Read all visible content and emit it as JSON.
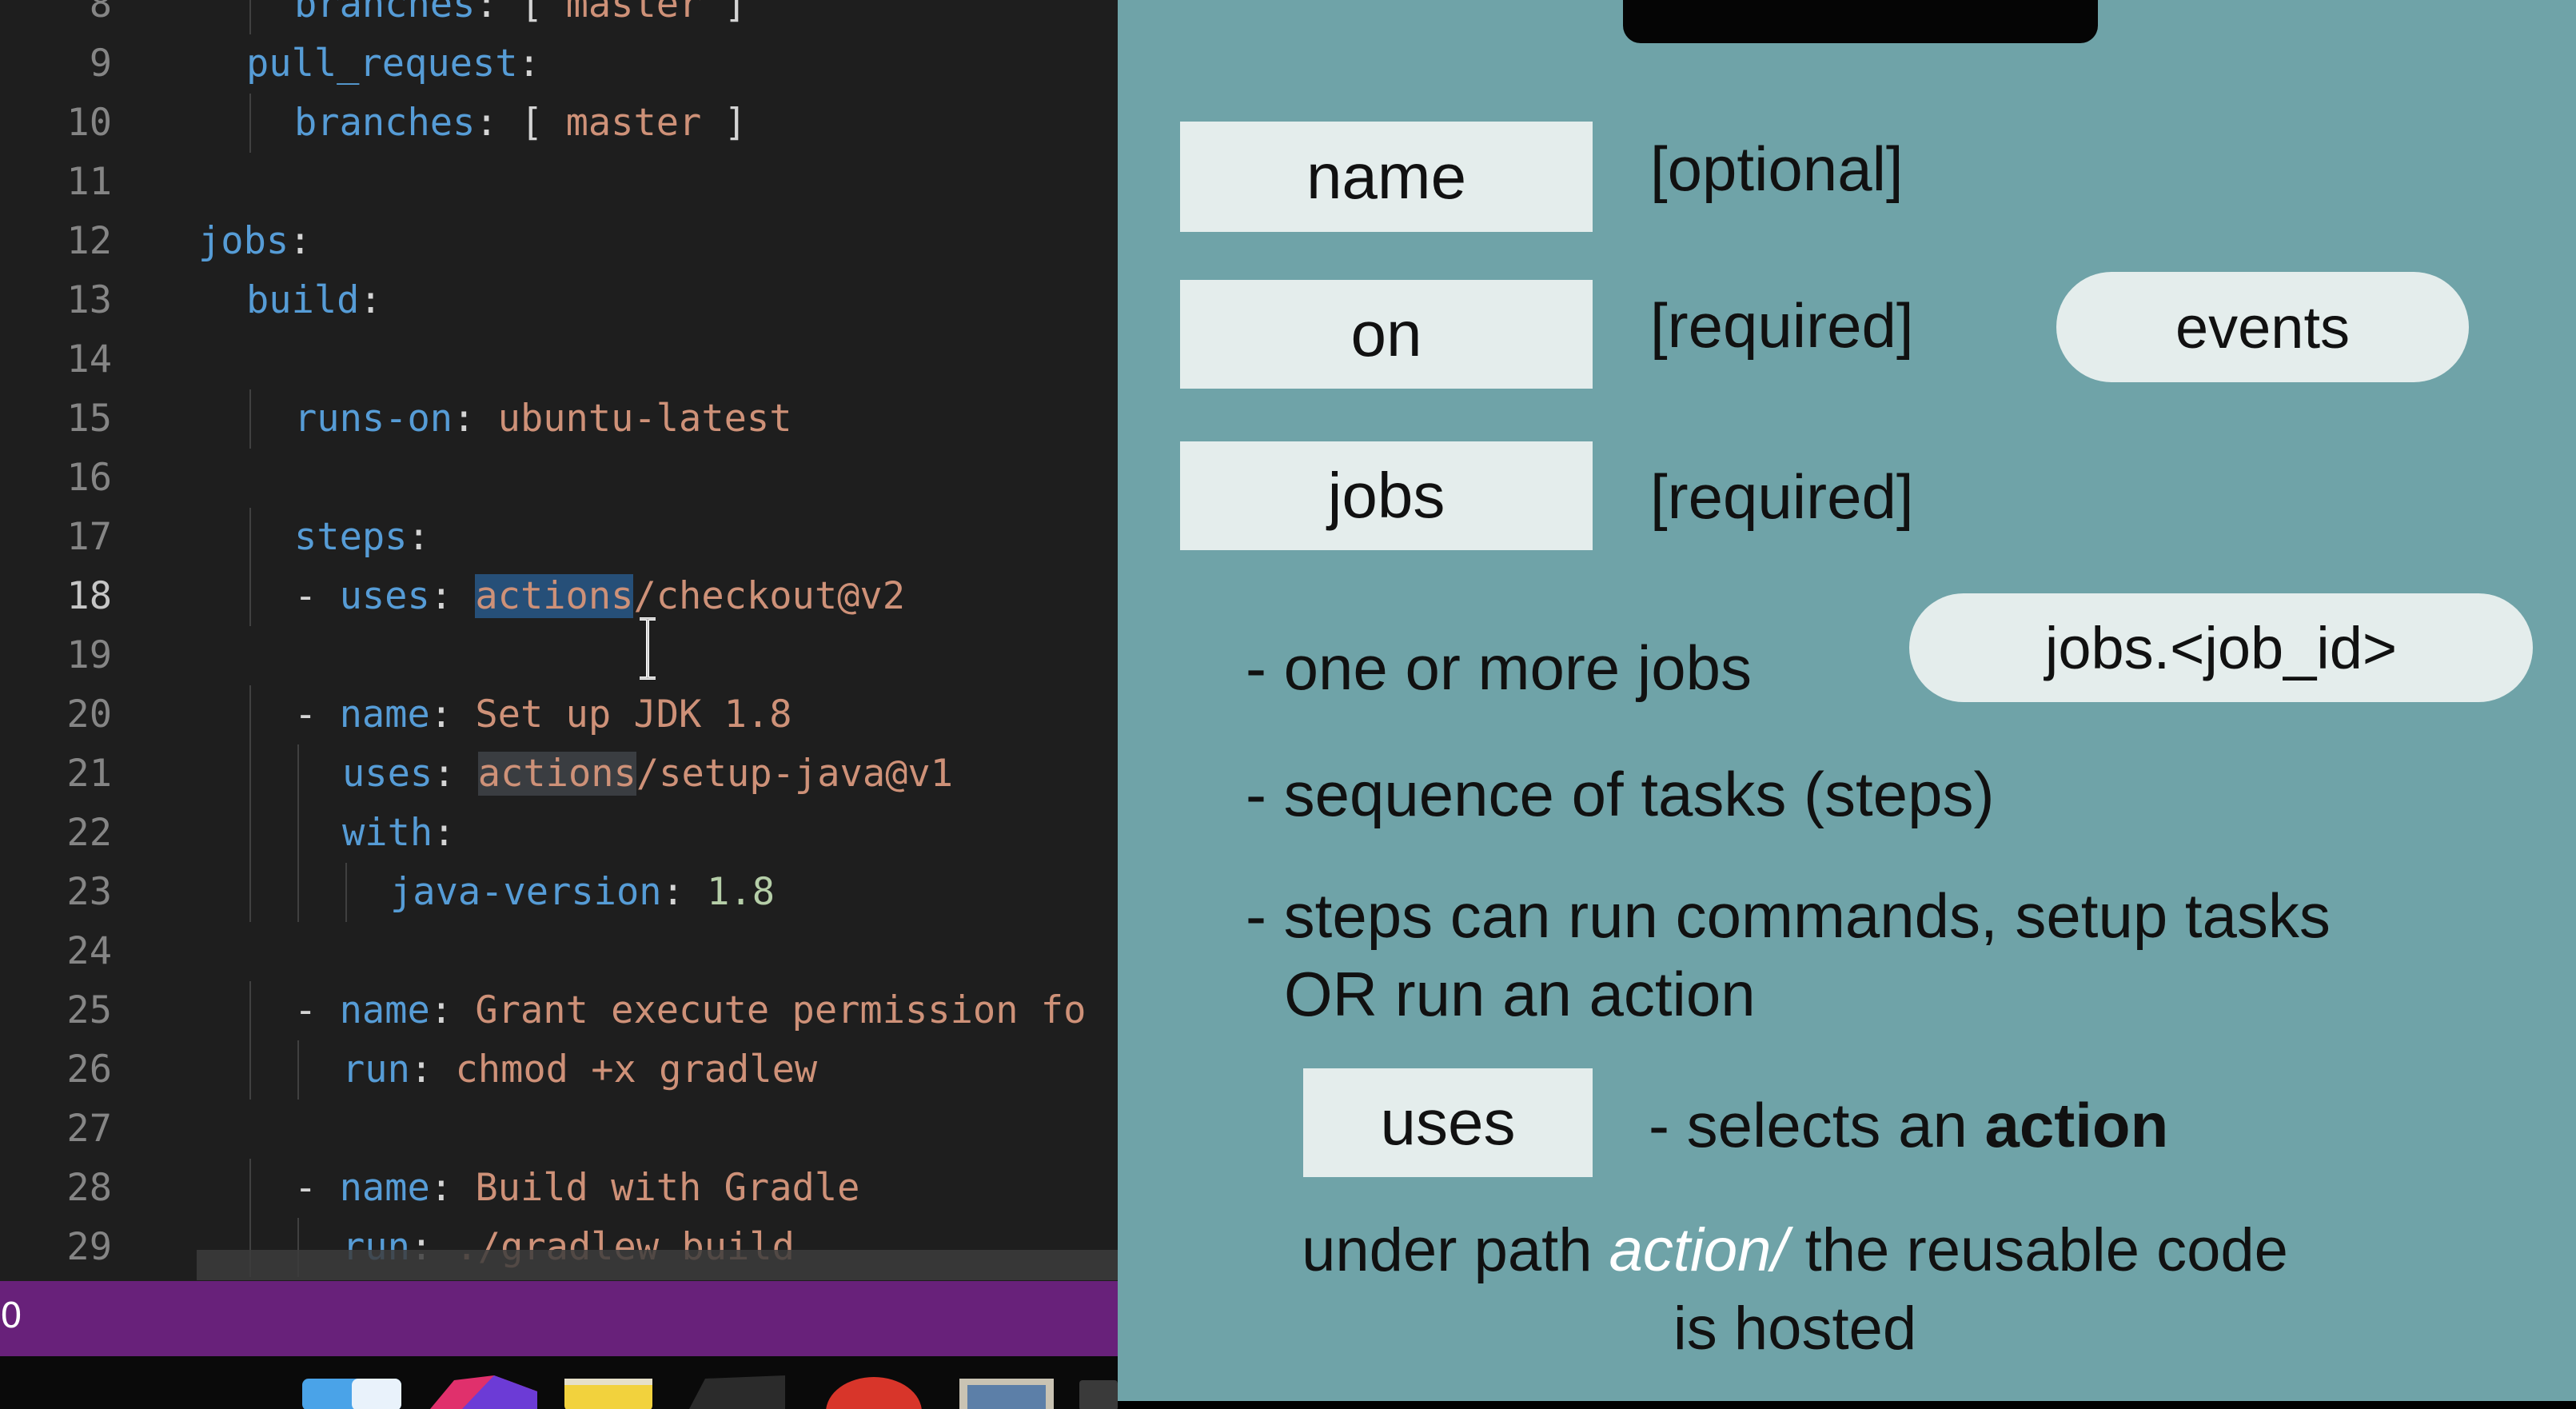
{
  "editor": {
    "lines": [
      {
        "n": "8",
        "indent": 2,
        "parts": [
          [
            "key",
            "branches"
          ],
          [
            "pun",
            ": [ "
          ],
          [
            "str",
            "master"
          ],
          [
            "pun",
            " ]"
          ]
        ]
      },
      {
        "n": "9",
        "indent": 1,
        "parts": [
          [
            "key",
            "pull_request"
          ],
          [
            "pun",
            ":"
          ]
        ]
      },
      {
        "n": "10",
        "indent": 2,
        "parts": [
          [
            "key",
            "branches"
          ],
          [
            "pun",
            ": [ "
          ],
          [
            "str",
            "master"
          ],
          [
            "pun",
            " ]"
          ]
        ]
      },
      {
        "n": "11",
        "indent": 0,
        "parts": []
      },
      {
        "n": "12",
        "indent": 0,
        "parts": [
          [
            "key",
            "jobs"
          ],
          [
            "pun",
            ":"
          ]
        ]
      },
      {
        "n": "13",
        "indent": 1,
        "parts": [
          [
            "key",
            "build"
          ],
          [
            "pun",
            ":"
          ]
        ]
      },
      {
        "n": "14",
        "indent": 0,
        "parts": []
      },
      {
        "n": "15",
        "indent": 2,
        "parts": [
          [
            "key",
            "runs-on"
          ],
          [
            "pun",
            ": "
          ],
          [
            "str",
            "ubuntu-latest"
          ]
        ]
      },
      {
        "n": "16",
        "indent": 0,
        "parts": []
      },
      {
        "n": "17",
        "indent": 2,
        "parts": [
          [
            "key",
            "steps"
          ],
          [
            "pun",
            ":"
          ]
        ]
      },
      {
        "n": "18",
        "indent": 2,
        "active": true,
        "parts": [
          [
            "pun",
            "- "
          ],
          [
            "key",
            "uses"
          ],
          [
            "pun",
            ": "
          ],
          [
            "str hl",
            "actions"
          ],
          [
            "str",
            "/checkout@v2"
          ]
        ]
      },
      {
        "n": "19",
        "indent": 0,
        "parts": []
      },
      {
        "n": "20",
        "indent": 2,
        "parts": [
          [
            "pun",
            "- "
          ],
          [
            "key",
            "name"
          ],
          [
            "pun",
            ": "
          ],
          [
            "str",
            "Set up JDK 1.8"
          ]
        ]
      },
      {
        "n": "21",
        "indent": 3,
        "parts": [
          [
            "key",
            "uses"
          ],
          [
            "pun",
            ": "
          ],
          [
            "str hl2",
            "actions"
          ],
          [
            "str",
            "/setup-java@v1"
          ]
        ]
      },
      {
        "n": "22",
        "indent": 3,
        "parts": [
          [
            "key",
            "with"
          ],
          [
            "pun",
            ":"
          ]
        ]
      },
      {
        "n": "23",
        "indent": 4,
        "parts": [
          [
            "key",
            "java-version"
          ],
          [
            "pun",
            ": "
          ],
          [
            "num",
            "1.8"
          ]
        ]
      },
      {
        "n": "24",
        "indent": 0,
        "parts": []
      },
      {
        "n": "25",
        "indent": 2,
        "parts": [
          [
            "pun",
            "- "
          ],
          [
            "key",
            "name"
          ],
          [
            "pun",
            ": "
          ],
          [
            "str",
            "Grant execute permission fo"
          ]
        ]
      },
      {
        "n": "26",
        "indent": 3,
        "parts": [
          [
            "key",
            "run"
          ],
          [
            "pun",
            ": "
          ],
          [
            "str",
            "chmod +x gradlew"
          ]
        ]
      },
      {
        "n": "27",
        "indent": 0,
        "parts": []
      },
      {
        "n": "28",
        "indent": 2,
        "parts": [
          [
            "pun",
            "- "
          ],
          [
            "key",
            "name"
          ],
          [
            "pun",
            ": "
          ],
          [
            "str",
            "Build with Gradle"
          ]
        ]
      },
      {
        "n": "29",
        "indent": 3,
        "parts": [
          [
            "key",
            "run"
          ],
          [
            "pun",
            ": "
          ],
          [
            "str",
            "./gradlew build"
          ]
        ]
      }
    ]
  },
  "statusbar": {
    "left_text": "0"
  },
  "slide": {
    "name_label": "name",
    "name_note": "[optional]",
    "on_label": "on",
    "on_note": "[required]",
    "on_pill": "events",
    "jobs_label": "jobs",
    "jobs_note": "[required]",
    "bullet1": "- one or more jobs",
    "jobs_pill": "jobs.<job_id>",
    "bullet2": "- sequence of tasks (steps)",
    "bullet3_line1": "- steps can run commands, setup tasks",
    "bullet3_line2": "OR run an action",
    "uses_label": "uses",
    "uses_note_prefix": "- selects an ",
    "uses_note_bold": "action",
    "footer_prefix": "under path ",
    "footer_italic": "action/",
    "footer_suffix": " the reusable code",
    "footer_line2": "is hosted"
  }
}
